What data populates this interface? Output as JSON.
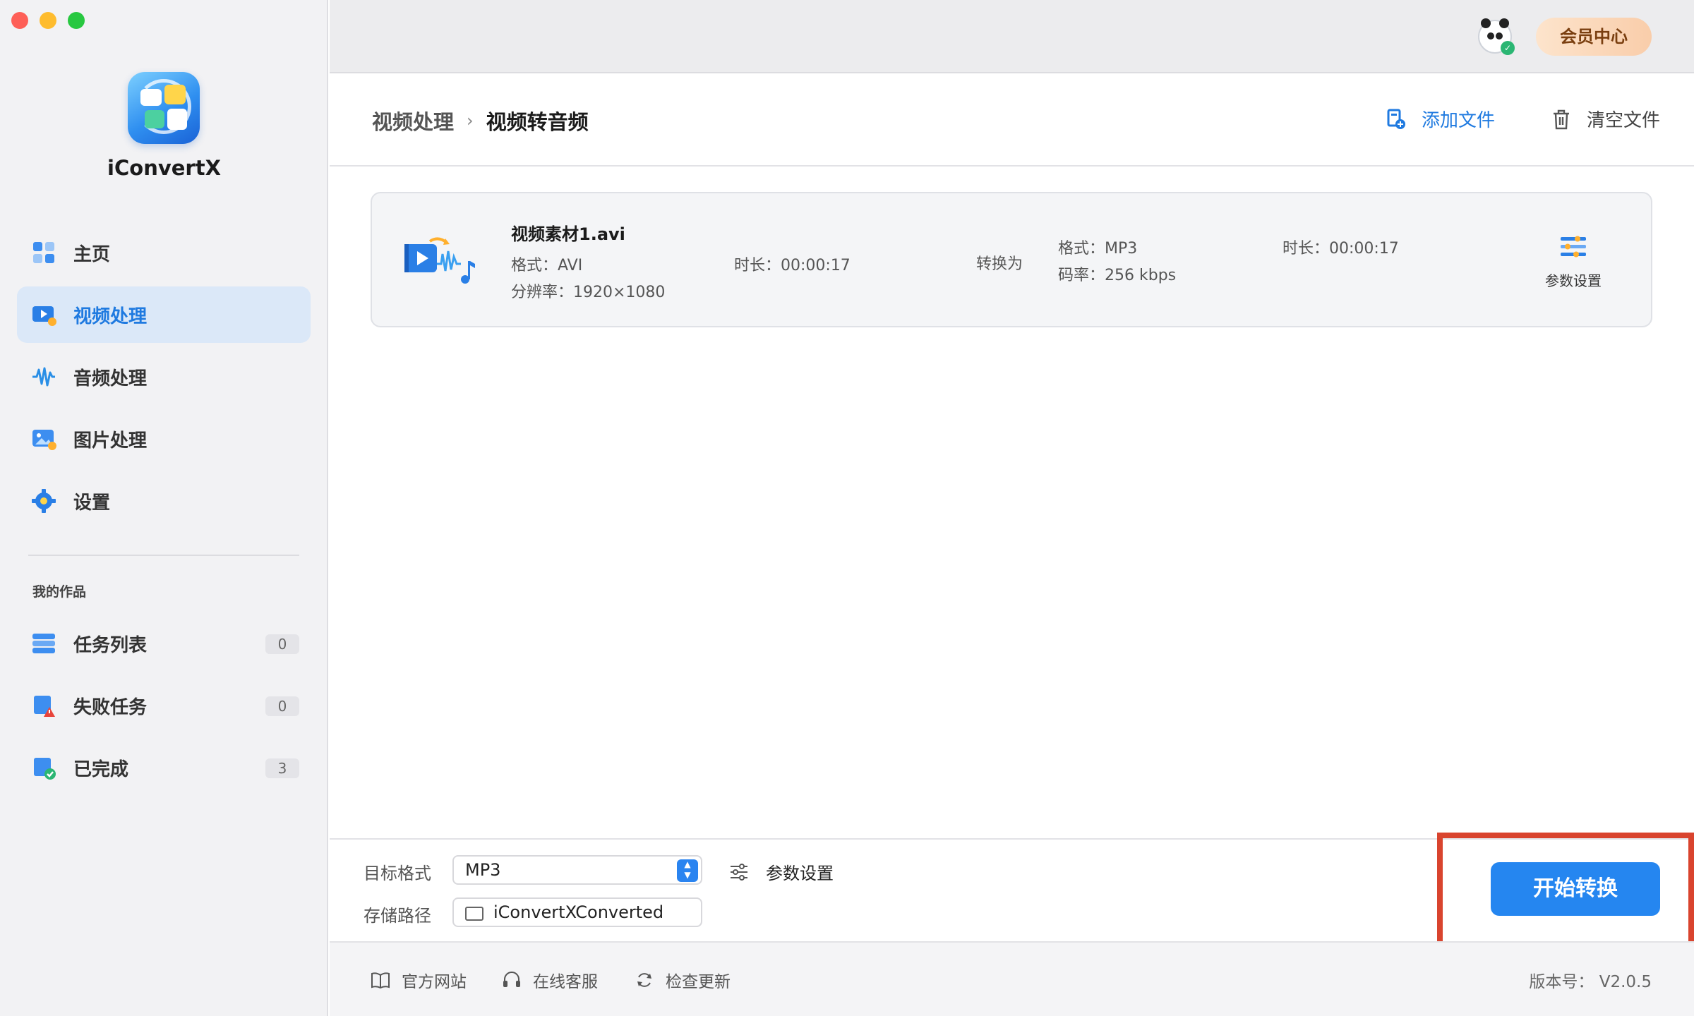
{
  "app": {
    "name": "iConvertX"
  },
  "sidebar": {
    "items": [
      {
        "label": "主页",
        "icon": "home-icon"
      },
      {
        "label": "视频处理",
        "icon": "video-process-icon",
        "active": true
      },
      {
        "label": "音频处理",
        "icon": "audio-wave-icon"
      },
      {
        "label": "图片处理",
        "icon": "image-process-icon"
      },
      {
        "label": "设置",
        "icon": "gear-icon"
      }
    ],
    "works_title": "我的作品",
    "works": [
      {
        "label": "任务列表",
        "count": "0",
        "icon": "task-list-icon"
      },
      {
        "label": "失败任务",
        "count": "0",
        "icon": "failed-task-icon"
      },
      {
        "label": "已完成",
        "count": "3",
        "icon": "completed-icon"
      }
    ]
  },
  "topbar": {
    "vip_label": "会员中心"
  },
  "header": {
    "breadcrumb_parent": "视频处理",
    "breadcrumb_sep": "›",
    "breadcrumb_current": "视频转音频",
    "add_file": "添加文件",
    "clear_files": "清空文件"
  },
  "file": {
    "name": "视频素材1.avi",
    "source_format": "格式：AVI",
    "source_duration": "时长：00:00:17",
    "resolution": "分辨率：1920×1080",
    "convert_to": "转换为",
    "target_format": "格式：MP3",
    "bitrate": "码率：256 kbps",
    "target_duration": "时长：00:00:17",
    "param_label": "参数设置"
  },
  "bottom": {
    "format_label": "目标格式",
    "format_value": "MP3",
    "path_label": "存储路径",
    "path_value": "iConvertXConverted",
    "param_label": "参数设置",
    "start_label": "开始转换"
  },
  "footer": {
    "website": "官方网站",
    "support": "在线客服",
    "update": "检查更新",
    "version": "版本号：  V2.0.5"
  },
  "colors": {
    "accent": "#2586f0",
    "active_nav_bg": "#dbe8f8",
    "highlight": "#d9442e"
  }
}
